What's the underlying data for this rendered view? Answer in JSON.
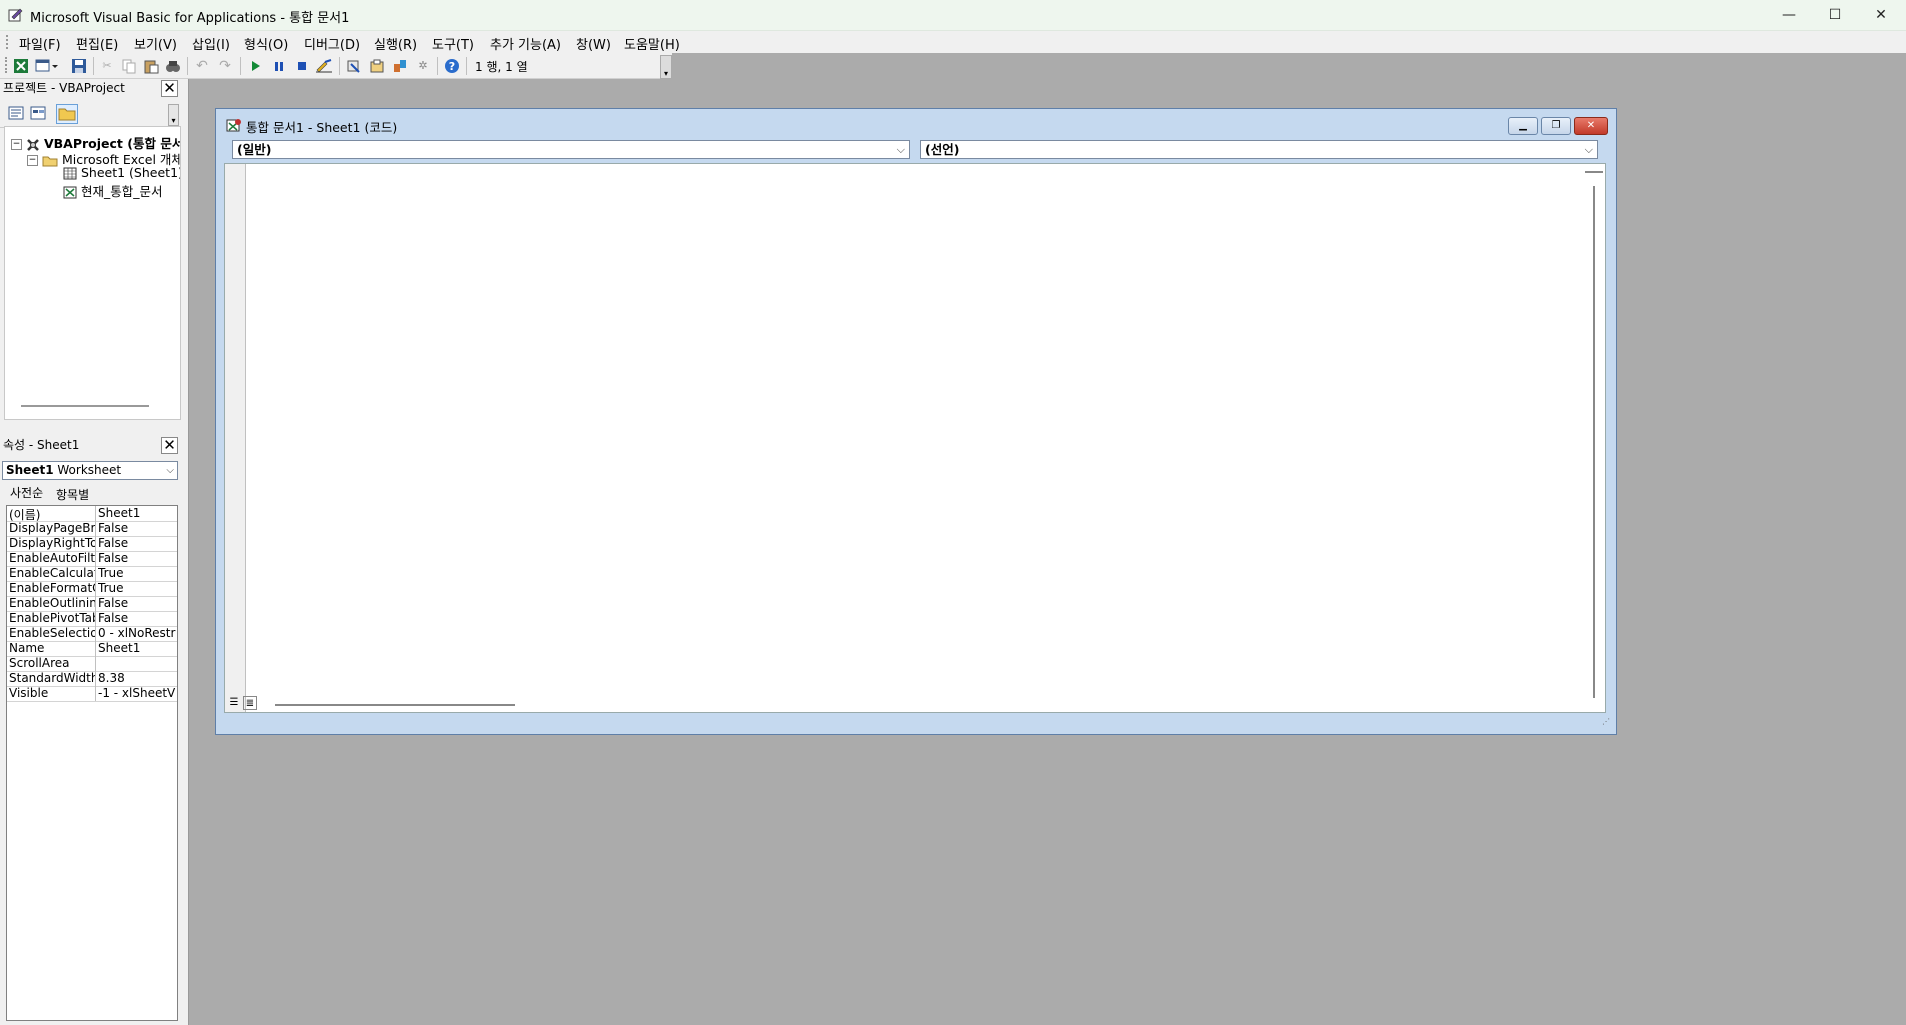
{
  "window": {
    "title": "Microsoft Visual Basic for Applications - 통합 문서1",
    "controls": {
      "minimize": "—",
      "maximize": "☐",
      "close": "✕"
    }
  },
  "menu": [
    "파일(F)",
    "편집(E)",
    "보기(V)",
    "삽입(I)",
    "형식(O)",
    "디버그(D)",
    "실행(R)",
    "도구(T)",
    "추가 기능(A)",
    "창(W)",
    "도움말(H)"
  ],
  "toolbar": {
    "position_text": "1 행, 1 열",
    "icons": [
      "excel-icon",
      "insert-form-icon",
      "save-icon",
      "cut-icon",
      "copy-icon",
      "paste-icon",
      "find-icon",
      "undo-icon",
      "redo-icon",
      "run-icon",
      "break-icon",
      "reset-icon",
      "design-mode-icon",
      "project-explorer-icon",
      "properties-icon",
      "object-browser-icon",
      "toolbox-icon",
      "help-icon"
    ]
  },
  "project_pane": {
    "title": "프로젝트 - VBAProject",
    "tree": [
      {
        "label": "VBAProject (통합 문서",
        "level": 0,
        "bold": true,
        "expander": "−"
      },
      {
        "label": "Microsoft Excel 개체",
        "level": 1,
        "bold": false,
        "expander": "−"
      },
      {
        "label": "Sheet1 (Sheet1)",
        "level": 2,
        "bold": false
      },
      {
        "label": "현재_통합_문서",
        "level": 2,
        "bold": false
      }
    ]
  },
  "properties_pane": {
    "title": "속성 - Sheet1",
    "object_name": "Sheet1",
    "object_type": "Worksheet",
    "tabs": [
      "사전순",
      "항목별"
    ],
    "rows": [
      {
        "name": "(이름)",
        "value": "Sheet1"
      },
      {
        "name": "DisplayPageBr",
        "value": "False"
      },
      {
        "name": "DisplayRightTo",
        "value": "False"
      },
      {
        "name": "EnableAutoFilte",
        "value": "False"
      },
      {
        "name": "EnableCalculat",
        "value": "True"
      },
      {
        "name": "EnableFormatC",
        "value": "True"
      },
      {
        "name": "EnableOutlining",
        "value": "False"
      },
      {
        "name": "EnablePivotTab",
        "value": "False"
      },
      {
        "name": "EnableSelectio",
        "value": "0 - xlNoRestri"
      },
      {
        "name": "Name",
        "value": "Sheet1"
      },
      {
        "name": "ScrollArea",
        "value": ""
      },
      {
        "name": "StandardWidth",
        "value": "8.38"
      },
      {
        "name": "Visible",
        "value": "-1 - xlSheetV"
      }
    ]
  },
  "code_window": {
    "title": "통합 문서1 - Sheet1 (코드)",
    "object_combo": "(일반)",
    "procedure_combo": "(선언)"
  }
}
